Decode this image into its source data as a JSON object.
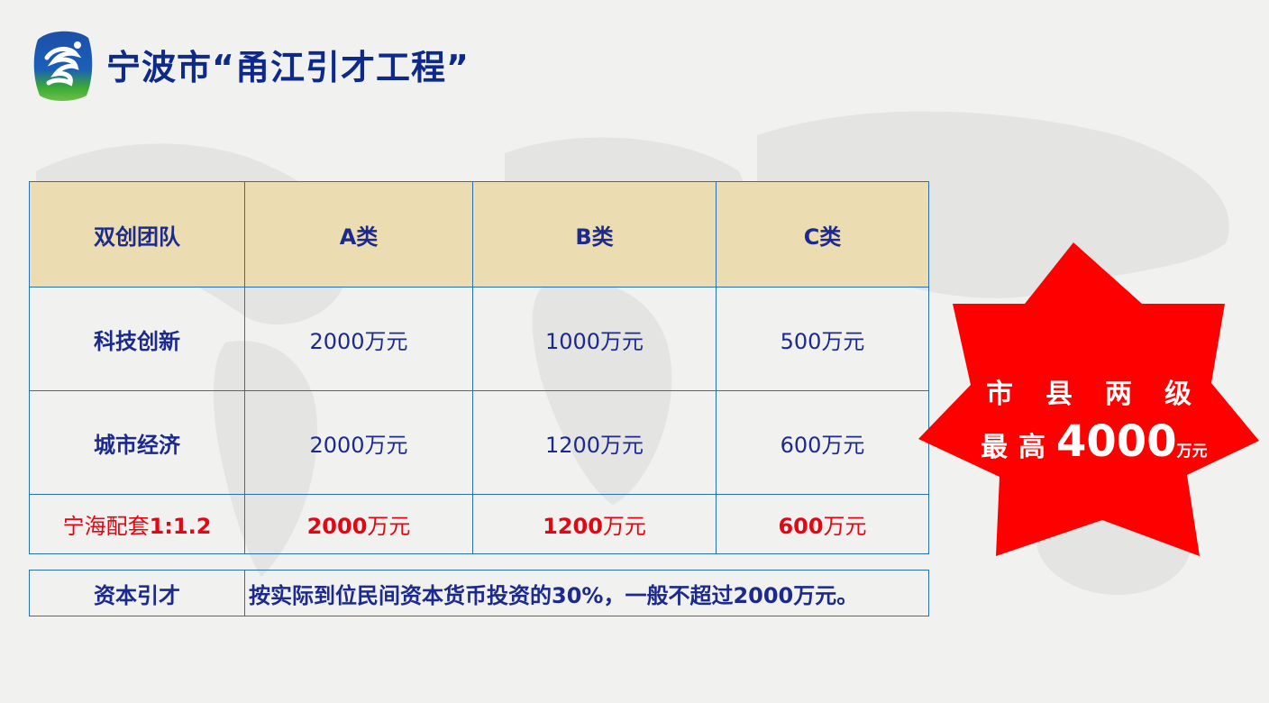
{
  "page": {
    "title": "宁波市“甬江引才工程”"
  },
  "grant_table": {
    "header": [
      "双创团队",
      "A类",
      "B类",
      "C类"
    ],
    "rows": [
      {
        "label": "科技创新",
        "a": "2000万元",
        "b": "1000万元",
        "c": "500万元"
      },
      {
        "label": "城市经济",
        "a": "2000万元",
        "b": "1200万元",
        "c": "600万元"
      }
    ],
    "match_row": {
      "label_prefix": "宁海配套",
      "label_ratio": "1:1.2",
      "a_num": "2000",
      "b_num": "1200",
      "c_num": "600",
      "unit": "万元"
    }
  },
  "capital_row": {
    "label": "资本引才",
    "description": "按实际到位民间资本货币投资的30%，一般不超过2000万元。"
  },
  "star_badge": {
    "line1": [
      "市",
      "县",
      "两",
      "级"
    ],
    "line2_prefix": "最高",
    "amount": "4000",
    "unit": "万元",
    "color": "#ff0000"
  },
  "colors": {
    "title": "#0d2a8a",
    "table_text": "#1b2a8c",
    "header_bg": "#ecdcb2",
    "border": "#2a6fb3",
    "highlight": "#e30613"
  }
}
